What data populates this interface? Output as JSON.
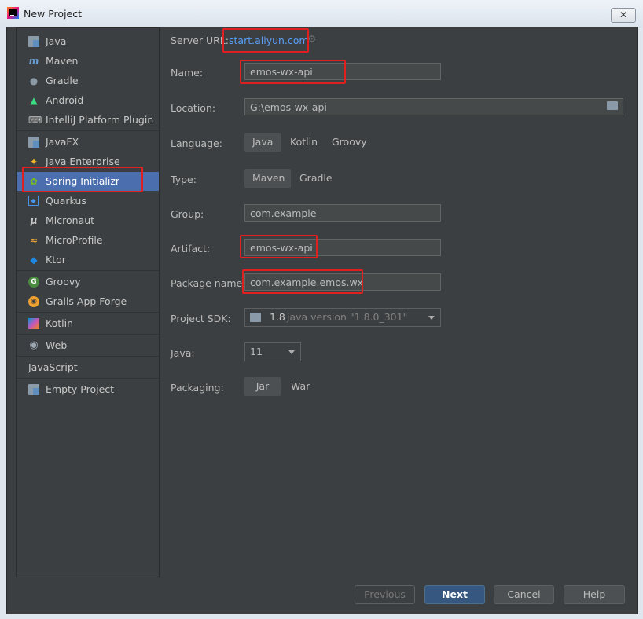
{
  "window": {
    "title": "New Project",
    "close_label": "✕"
  },
  "sidebar": {
    "items": [
      {
        "label": "Java",
        "icon": "folder-icon"
      },
      {
        "label": "Maven",
        "icon": "maven-icon"
      },
      {
        "label": "Gradle",
        "icon": "gradle-elephant-icon"
      },
      {
        "label": "Android",
        "icon": "android-icon"
      },
      {
        "label": "IntelliJ Platform Plugin",
        "icon": "plugin-icon"
      },
      {
        "label": "JavaFX",
        "icon": "folder-icon"
      },
      {
        "label": "Java Enterprise",
        "icon": "java-enterprise-icon"
      },
      {
        "label": "Spring Initializr",
        "icon": "spring-icon",
        "selected": true
      },
      {
        "label": "Quarkus",
        "icon": "quarkus-icon"
      },
      {
        "label": "Micronaut",
        "icon": "micronaut-icon"
      },
      {
        "label": "MicroProfile",
        "icon": "microprofile-icon"
      },
      {
        "label": "Ktor",
        "icon": "ktor-icon"
      },
      {
        "label": "Groovy",
        "icon": "groovy-icon"
      },
      {
        "label": "Grails App Forge",
        "icon": "grails-icon"
      },
      {
        "label": "Kotlin",
        "icon": "kotlin-icon"
      },
      {
        "label": "Web",
        "icon": "globe-icon"
      },
      {
        "label": "JavaScript",
        "icon": ""
      },
      {
        "label": "Empty Project",
        "icon": "folder-icon"
      }
    ]
  },
  "form": {
    "server_url_label": "Server URL:",
    "server_url": "start.aliyun.com",
    "name_label": "Name:",
    "name_value": "emos-wx-api",
    "location_label": "Location:",
    "location_value": "G:\\emos-wx-api",
    "language_label": "Language:",
    "language_options": [
      "Java",
      "Kotlin",
      "Groovy"
    ],
    "language_selected": "Java",
    "type_label": "Type:",
    "type_options": [
      "Maven",
      "Gradle"
    ],
    "type_selected": "Maven",
    "group_label": "Group:",
    "group_value": "com.example",
    "artifact_label": "Artifact:",
    "artifact_value": "emos-wx-api",
    "package_label": "Package name:",
    "package_value": "com.example.emos.wx",
    "sdk_label": "Project SDK:",
    "sdk_version": "1.8",
    "sdk_detail": "java version \"1.8.0_301\"",
    "java_label": "Java:",
    "java_value": "11",
    "packaging_label": "Packaging:",
    "packaging_options": [
      "Jar",
      "War"
    ],
    "packaging_selected": "Jar"
  },
  "buttons": {
    "previous": "Previous",
    "next": "Next",
    "cancel": "Cancel",
    "help": "Help"
  },
  "colors": {
    "accent": "#4b6eaf",
    "link": "#589df6",
    "highlight": "#e02020"
  }
}
